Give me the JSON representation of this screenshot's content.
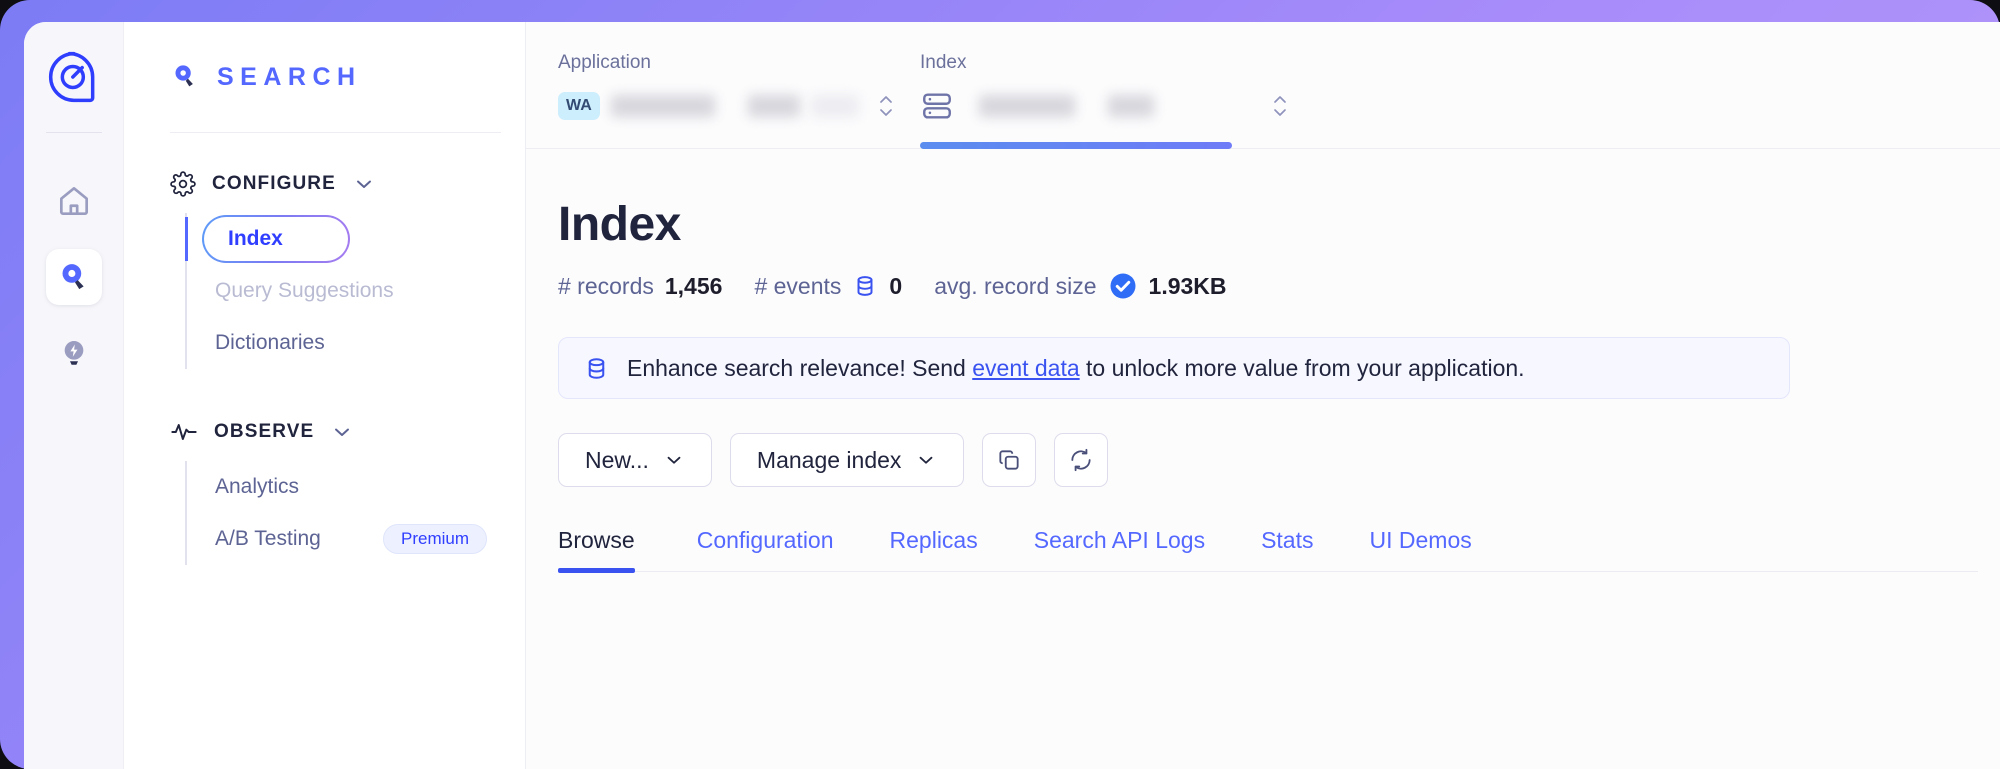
{
  "brand": {
    "name": "SEARCH",
    "logo_icon": "algolia-logo-icon",
    "mark_icon": "search-pin-icon"
  },
  "rail": {
    "items": [
      {
        "name": "home",
        "icon": "home-icon",
        "active": false
      },
      {
        "name": "search",
        "icon": "search-pin-icon",
        "active": true
      },
      {
        "name": "ideas",
        "icon": "lightbulb-bolt-icon",
        "active": false
      }
    ]
  },
  "sidebar": {
    "groups": [
      {
        "title": "CONFIGURE",
        "icon": "gear-icon",
        "chevron": "chevron-down-icon",
        "items": [
          {
            "label": "Index",
            "state": "active"
          },
          {
            "label": "Query Suggestions",
            "state": "muted"
          },
          {
            "label": "Dictionaries",
            "state": "normal"
          }
        ]
      },
      {
        "title": "OBSERVE",
        "icon": "pulse-icon",
        "chevron": "chevron-down-icon",
        "items": [
          {
            "label": "Analytics",
            "state": "normal"
          },
          {
            "label": "A/B Testing",
            "state": "normal",
            "badge": "Premium"
          }
        ]
      }
    ]
  },
  "selectors": {
    "application": {
      "label": "Application",
      "badge": "WA",
      "value_redacted": true,
      "stepper_icon": "stepper-up-down-icon"
    },
    "index": {
      "label": "Index",
      "icon": "database-stack-icon",
      "value_redacted": true,
      "stepper_icon": "stepper-up-down-icon",
      "progress_percent": 100,
      "progress_color": "#5b8def"
    }
  },
  "page": {
    "title": "Index",
    "stats": [
      {
        "label": "# records",
        "value": "1,456",
        "icon": null
      },
      {
        "label": "# events",
        "value": "0",
        "icon": "database-icon"
      },
      {
        "label": "avg. record size",
        "value": "1.93KB",
        "icon": "check-circle-icon"
      }
    ],
    "notice": {
      "icon": "database-icon",
      "text_before": "Enhance search relevance! Send ",
      "link": "event data",
      "text_after": " to unlock more value from your application."
    },
    "actions": [
      {
        "label": "New...",
        "icon": "chevron-down-icon",
        "name": "new-button"
      },
      {
        "label": "Manage index",
        "icon": "chevron-down-icon",
        "name": "manage-index-button"
      },
      {
        "label": "",
        "icon": "copy-icon",
        "name": "copy-index-button"
      },
      {
        "label": "",
        "icon": "refresh-icon",
        "name": "refresh-index-button"
      }
    ],
    "tabs": [
      {
        "label": "Browse",
        "active": true
      },
      {
        "label": "Configuration",
        "active": false
      },
      {
        "label": "Replicas",
        "active": false
      },
      {
        "label": "Search API Logs",
        "active": false
      },
      {
        "label": "Stats",
        "active": false
      },
      {
        "label": "UI Demos",
        "active": false
      }
    ]
  },
  "colors": {
    "accent": "#5468ff",
    "accent_strong": "#3a53f0",
    "frame": "#a78bfa",
    "text": "#21243d",
    "muted": "#5d6494"
  }
}
